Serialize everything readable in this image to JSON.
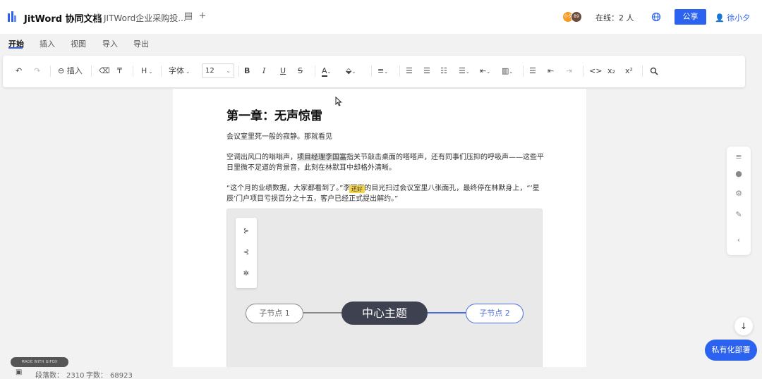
{
  "header": {
    "app_title": "JitWord 协同文档",
    "doc_title": "JITWord企业采购投...",
    "online": "在线：2 人",
    "share_label": "公享",
    "user_name": "徐小夕",
    "avatars": [
      "小夕",
      "89"
    ]
  },
  "menu": {
    "tabs": [
      "开始",
      "插入",
      "视图",
      "导入",
      "导出"
    ],
    "active": "开始"
  },
  "toolbar": {
    "insert_label": "插入",
    "heading_label": "H",
    "font_label": "字体",
    "font_size": "12",
    "bold": "B",
    "italic": "I",
    "underline": "U",
    "strike": "S",
    "code": "<>",
    "subscript": "x₂",
    "superscript": "x²"
  },
  "document": {
    "title": "第一章：无声惊雷",
    "para1": "会议室里死一般的寂静。那就看见",
    "para2_before": "空调出风口的嗡嗡声，",
    "para2_highlight": "项目经理李国富",
    "para2_after": "指关节敲击桌面的嗒嗒声，还有同事们压抑的呼吸声——这些平日里微不足道的背景音，此刻在林默耳中却格外清晰。",
    "para3": "“这个月的业绩数据，大家都看到了。”李国富的目光扫过会议室里八张面孔，最终停在林默身上，“‘星辰’门户项目亏损百分之十五，客户已经正式提出解约。”",
    "note_tag": "还好"
  },
  "mindmap": {
    "center": "中心主题",
    "child_left": "子节点 1",
    "child_right": "子节点 2",
    "colors": {
      "center": "#3d4150",
      "left_line": "#888888",
      "right_line": "#4a6be0"
    }
  },
  "floating": {
    "private_deploy": "私有化部署"
  },
  "statusbar": {
    "made_with": "MADE WITH GIFOX",
    "paragraph_count_label": "段落数：",
    "paragraph_count": "2310",
    "char_count_label": "字数：",
    "char_count": "68923"
  },
  "colors": {
    "accent": "#2c62f0",
    "background": "#f2f2f2"
  }
}
